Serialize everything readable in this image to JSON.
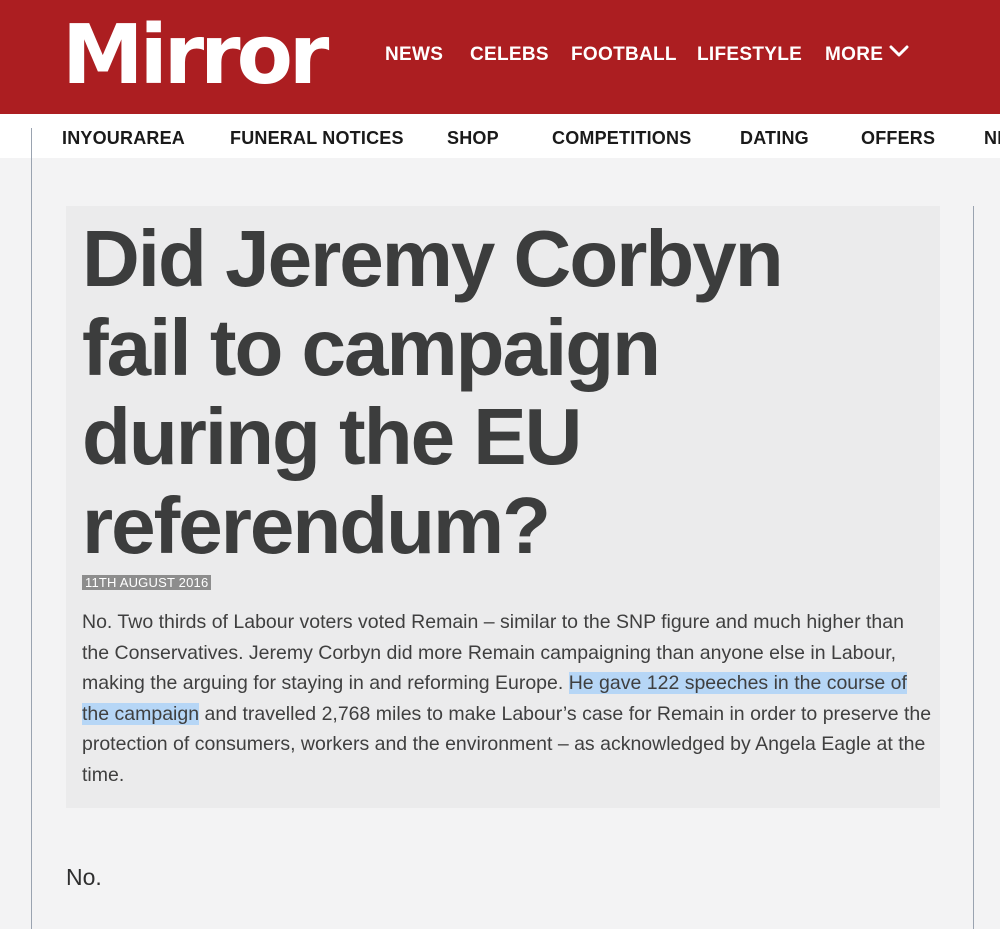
{
  "header": {
    "logo": "Mirror",
    "nav": [
      "NEWS",
      "CELEBS",
      "FOOTBALL",
      "LIFESTYLE",
      "MORE"
    ],
    "more_icon": "chevron-down-icon",
    "brand_color": "#ac1e21"
  },
  "subnav": {
    "items": [
      "INYOURAREA",
      "FUNERAL NOTICES",
      "SHOP",
      "COMPETITIONS",
      "DATING",
      "OFFERS",
      "NE"
    ]
  },
  "article": {
    "headline": "Did Jeremy Corbyn fail to campaign during the EU referendum?",
    "date": "11TH AUGUST 2016",
    "body_before": "No. Two thirds of Labour voters voted Remain – similar to the SNP figure and much higher than the Conservatives. Jeremy Corbyn did more Remain campaigning than anyone else in Labour, making the arguing for staying in and reforming Europe. ",
    "body_highlight": "He gave 122 speeches in the course of the campaign",
    "body_after": " and travelled 2,768 miles to make Labour’s case for Remain in order to preserve the protection of consumers, workers and the environment – as acknowledged by Angela Eagle at the time.",
    "highlight_color": "#b6d6f6"
  },
  "answer": "No."
}
